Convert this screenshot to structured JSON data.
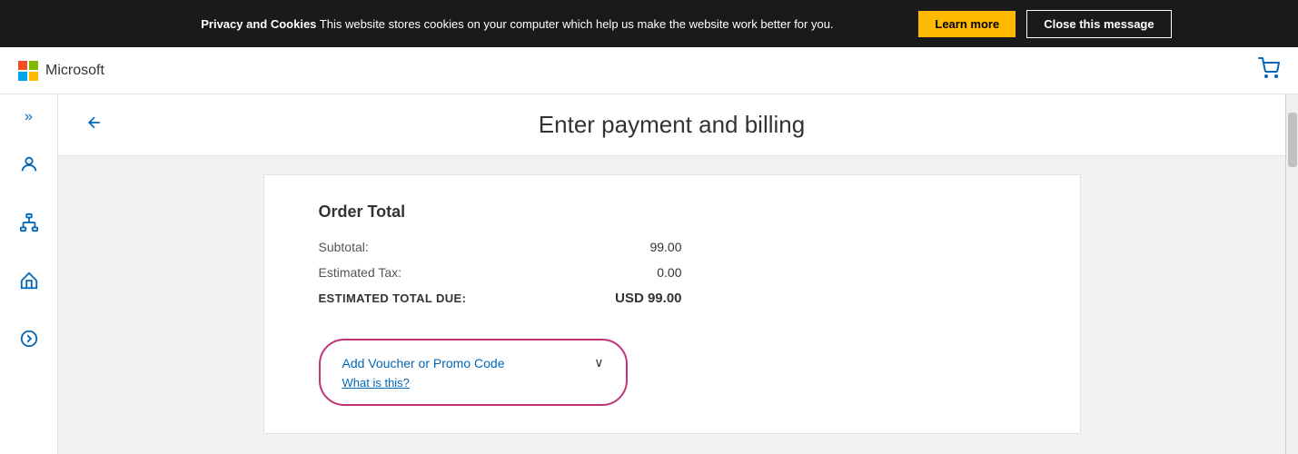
{
  "cookie_banner": {
    "text_bold": "Privacy and Cookies",
    "text_normal": " This website stores cookies on your computer which help us make the website work better for you.",
    "learn_more_label": "Learn more",
    "close_message_label": "Close this message"
  },
  "top_nav": {
    "brand_name": "Microsoft",
    "cart_icon_label": "cart"
  },
  "sidebar": {
    "expand_icon": "»",
    "icons": [
      "person",
      "network",
      "home",
      "arrow-right"
    ]
  },
  "page": {
    "title": "Enter payment and billing",
    "back_icon": "←"
  },
  "order": {
    "section_title": "Order Total",
    "subtotal_label": "Subtotal:",
    "subtotal_value": "99.00",
    "tax_label": "Estimated Tax:",
    "tax_value": "0.00",
    "total_label": "ESTIMATED TOTAL DUE:",
    "total_value": "USD 99.00",
    "voucher_label": "Add Voucher or Promo Code",
    "what_is_this_label": "What is this?",
    "chevron_down": "∨"
  }
}
